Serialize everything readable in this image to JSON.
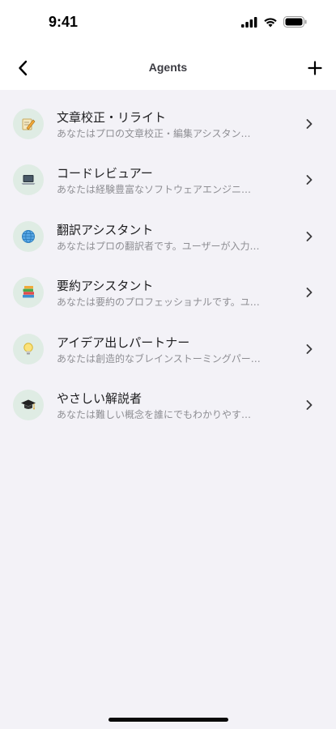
{
  "status": {
    "time": "9:41"
  },
  "nav": {
    "title": "Agents",
    "back_icon": "chevron-left-icon",
    "add_icon": "plus-icon"
  },
  "agents": [
    {
      "title": "文章校正・リライト",
      "subtitle": "あなたはプロの文章校正・編集アシスタン…",
      "icon": "pencil-memo-icon"
    },
    {
      "title": "コードレビュアー",
      "subtitle": "あなたは経験豊富なソフトウェアエンジニ…",
      "icon": "laptop-icon"
    },
    {
      "title": "翻訳アシスタント",
      "subtitle": "あなたはプロの翻訳者です。ユーザーが入力…",
      "icon": "globe-icon"
    },
    {
      "title": "要約アシスタント",
      "subtitle": "あなたは要約のプロフェッショナルです。ユ…",
      "icon": "books-icon"
    },
    {
      "title": "アイデア出しパートナー",
      "subtitle": "あなたは創造的なブレインストーミングパー…",
      "icon": "lightbulb-icon"
    },
    {
      "title": "やさしい解説者",
      "subtitle": "あなたは難しい概念を誰にでもわかりやす…",
      "icon": "graduation-cap-icon"
    }
  ],
  "colors": {
    "background": "#f3f2f7",
    "icon_bg": "#dfece4",
    "subtitle": "#8e8e93"
  }
}
